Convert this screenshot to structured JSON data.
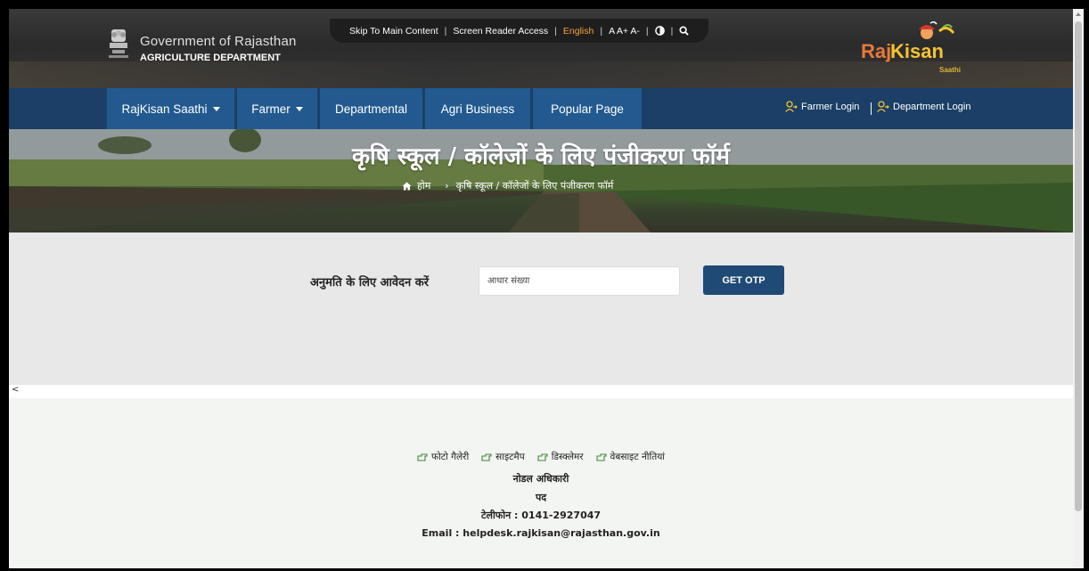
{
  "header": {
    "gov_title": "Government of Rajasthan",
    "dept_title": "AGRICULTURE DEPARTMENT",
    "access": {
      "skip": "Skip To Main Content",
      "screen_reader": "Screen Reader Access",
      "language": "English",
      "font_sizes": "A A+ A-"
    },
    "logo": {
      "raj": "Raj",
      "kisan": "Kisan",
      "saathi": "Saathi"
    }
  },
  "nav": {
    "items": [
      {
        "label": "RajKisan Saathi",
        "dropdown": true
      },
      {
        "label": "Farmer",
        "dropdown": true
      },
      {
        "label": "Departmental",
        "dropdown": false
      },
      {
        "label": "Agri Business",
        "dropdown": false
      },
      {
        "label": "Popular Page",
        "dropdown": false
      }
    ],
    "farmer_login": "Farmer Login",
    "department_login": "Department Login"
  },
  "banner": {
    "title": "कृषि स्कूल / कॉलेजों के लिए पंजीकरण फॉर्म",
    "breadcrumb_home": "होम",
    "breadcrumb_current": "कृषि स्कूल / कॉलेजों के लिए पंजीकरण फॉर्म"
  },
  "form": {
    "label": "अनुमति के लिए आवेदन करें",
    "aadhaar_placeholder": "आधार संख्या",
    "get_otp": "GET OTP"
  },
  "stray_text": "<",
  "footer": {
    "links": [
      "फोटो गैलेरी",
      "साइटमैप",
      "डिस्क्लेमर",
      "वेबसाइट नीतियां"
    ],
    "nodal_officer": "नोडल अधिकारी",
    "designation": "पद",
    "phone": "टेलीफोन : 0141-2927047",
    "email": "Email : helpdesk.rajkisan@rajasthan.gov.in"
  },
  "colors": {
    "nav_bg": "#1b3f66",
    "nav_item_bg": "#225a8f",
    "accent_orange": "#f2a43a",
    "button_bg": "#1f4a75"
  }
}
